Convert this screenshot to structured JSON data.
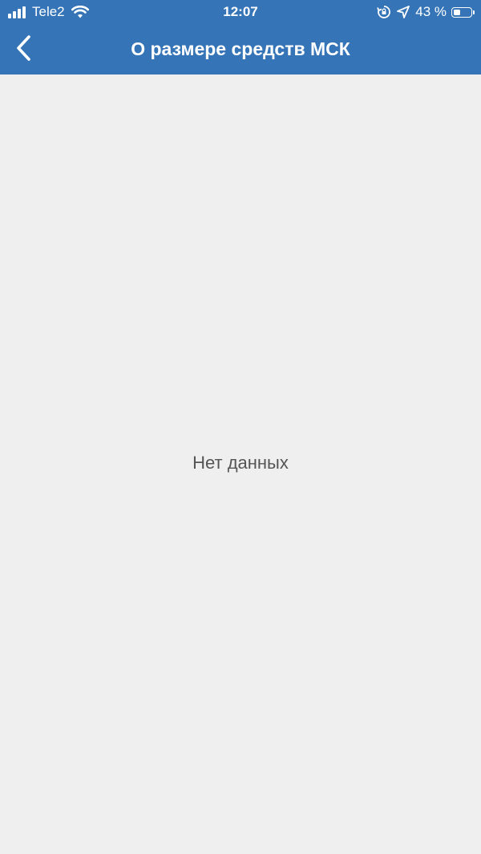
{
  "colors": {
    "header_bg": "#3474b7",
    "header_text": "#ffffff",
    "content_bg": "#efefef",
    "empty_text": "#555555"
  },
  "status_bar": {
    "carrier": "Tele2",
    "time": "12:07",
    "battery_percent": "43 %",
    "battery_level": 0.43,
    "icons": [
      "signal-icon",
      "wifi-icon",
      "orientation-lock-icon",
      "location-arrow-icon",
      "battery-icon"
    ]
  },
  "nav": {
    "back_icon": "chevron-left-icon",
    "title": "О размере средств МСК"
  },
  "content": {
    "empty_message": "Нет данных"
  }
}
